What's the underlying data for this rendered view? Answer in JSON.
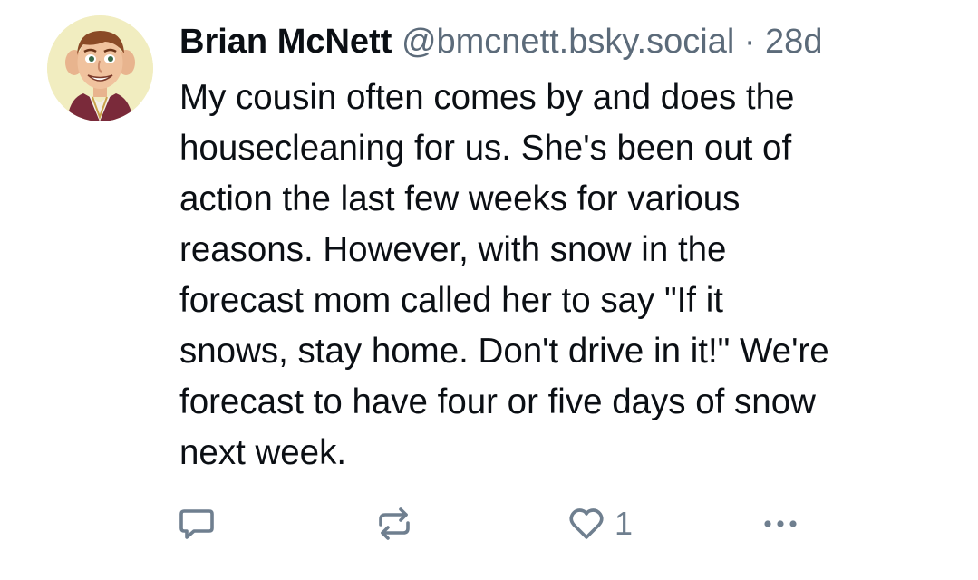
{
  "post": {
    "author": {
      "display_name": "Brian McNett",
      "handle": "@bmcnett.bsky.social",
      "avatar_icon": "cartoon-avatar"
    },
    "separator": "·",
    "timestamp": "28d",
    "text_lines": [
      "My cousin often comes by and does the",
      "housecleaning for us. She's been out of",
      "action the last few weeks for various",
      "reasons. However, with snow in the",
      "forecast mom called her to say \"If it",
      "snows, stay home. Don't drive in it!\" We're",
      "forecast to have four or five days of snow",
      "next week."
    ],
    "actions": {
      "reply_icon": "reply-icon",
      "repost_icon": "repost-icon",
      "like_icon": "heart-icon",
      "like_count": "1",
      "more_icon": "more-options-icon"
    }
  },
  "colors": {
    "text": "#0b0f14",
    "muted": "#5c6b7a",
    "icon": "#6f7f8f",
    "avatar_bg": "#f1edc0"
  }
}
